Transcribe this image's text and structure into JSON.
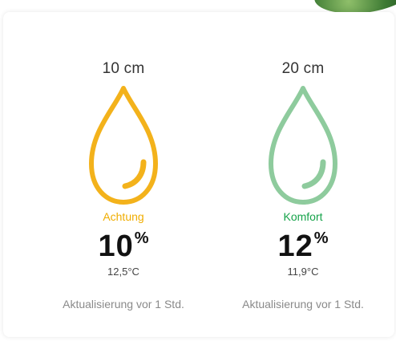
{
  "colors": {
    "warning": "#f3b21b",
    "comfort": "#7cc58f",
    "warning_text": "#f0ad00",
    "comfort_text": "#16a34a"
  },
  "sensors": [
    {
      "depth": "10 cm",
      "status": "Achtung",
      "humidity": "10",
      "unit": "%",
      "temperature": "12,5°C",
      "updated": "Aktualisierung vor 1 Std.",
      "icon": "water-drop-icon"
    },
    {
      "depth": "20 cm",
      "status": "Komfort",
      "humidity": "12",
      "unit": "%",
      "temperature": "11,9°C",
      "updated": "Aktualisierung vor 1 Std.",
      "icon": "water-drop-icon"
    }
  ]
}
